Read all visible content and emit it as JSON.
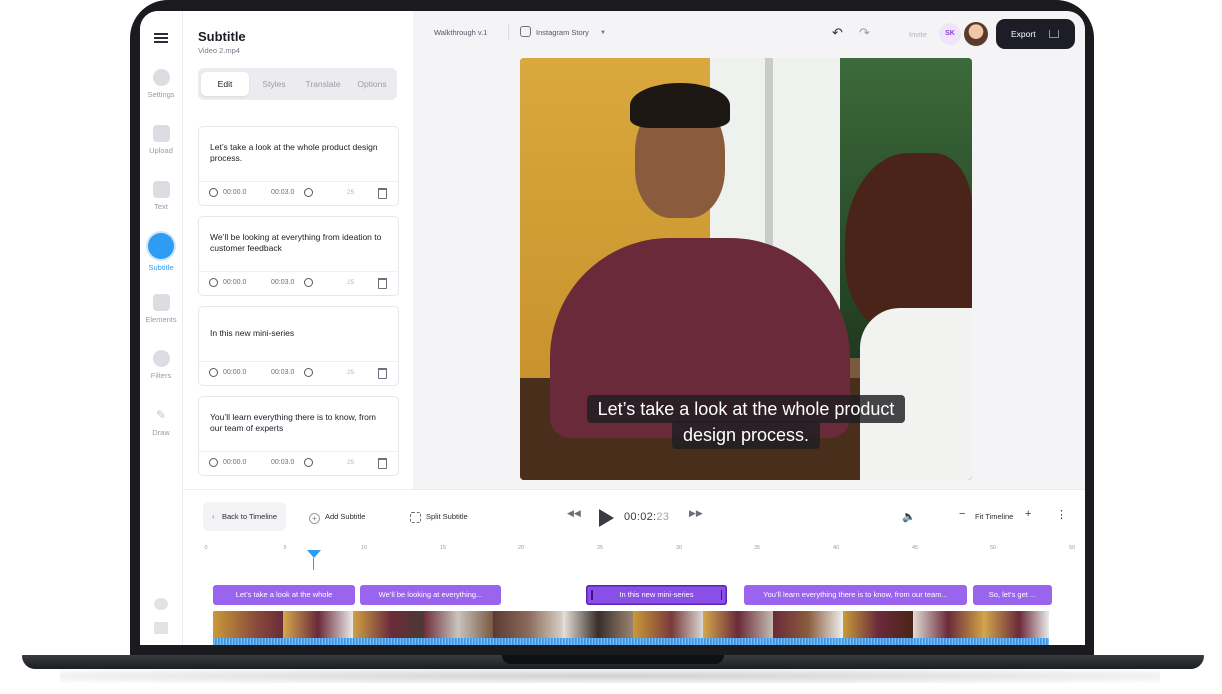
{
  "sidebar": {
    "items": [
      {
        "label": "Settings",
        "icon": "gear-icon"
      },
      {
        "label": "Upload",
        "icon": "image-icon"
      },
      {
        "label": "Text",
        "icon": "text-icon"
      },
      {
        "label": "Subtitle",
        "icon": "subtitle-icon",
        "active": true
      },
      {
        "label": "Elements",
        "icon": "elements-icon"
      },
      {
        "label": "Filters",
        "icon": "filters-icon"
      },
      {
        "label": "Draw",
        "icon": "pen-icon"
      }
    ]
  },
  "panel": {
    "title": "Subtitle",
    "file": "Video 2.mp4",
    "tabs": [
      "Edit",
      "Styles",
      "Translate",
      "Options"
    ],
    "active_tab": "Edit",
    "cards": [
      {
        "text": "Let’s take a look at the whole product design process.",
        "start": "00:00.0",
        "end": "00:03.0",
        "count": "25"
      },
      {
        "text": "We’ll be looking at everything from ideation to customer feedback",
        "start": "00:00.0",
        "end": "00:03.0",
        "count": "25"
      },
      {
        "text": "In this new mini-series",
        "start": "00:00.0",
        "end": "00:03.0",
        "count": "25"
      },
      {
        "text": "You’ll learn everything there is to know, from our team of experts",
        "start": "00:00.0",
        "end": "00:03.0",
        "count": "25"
      }
    ]
  },
  "topbar": {
    "project": "Walkthrough v.1",
    "format": "Instagram Story",
    "invite": "Invite",
    "avatar_initials": "SK",
    "export_label": "Export"
  },
  "video": {
    "caption_line1": "Let’s take a look at the whole product",
    "caption_line2": "design process."
  },
  "timeline": {
    "back_label": "Back to Timeline",
    "add_label": "Add Subtitle",
    "split_label": "Split Subtitle",
    "time_main": "00:02:",
    "time_frac": "23",
    "fit_label": "Fit Timeline",
    "ruler": [
      "0",
      "5",
      "10",
      "15",
      "20",
      "25",
      "30",
      "35",
      "40",
      "45",
      "50",
      "50"
    ],
    "clips": [
      {
        "label": "Let’s take a look at the whole"
      },
      {
        "label": "We’ll be looking at everything..."
      },
      {
        "label": "In this new mini-series",
        "selected": true
      },
      {
        "label": "You’ll learn everything there is to know, from our team..."
      },
      {
        "label": "So, let’s get ..."
      }
    ]
  },
  "colors": {
    "accent": "#2e9cf3",
    "clip": "#9b64ee",
    "export_bg": "#1c1d26"
  }
}
